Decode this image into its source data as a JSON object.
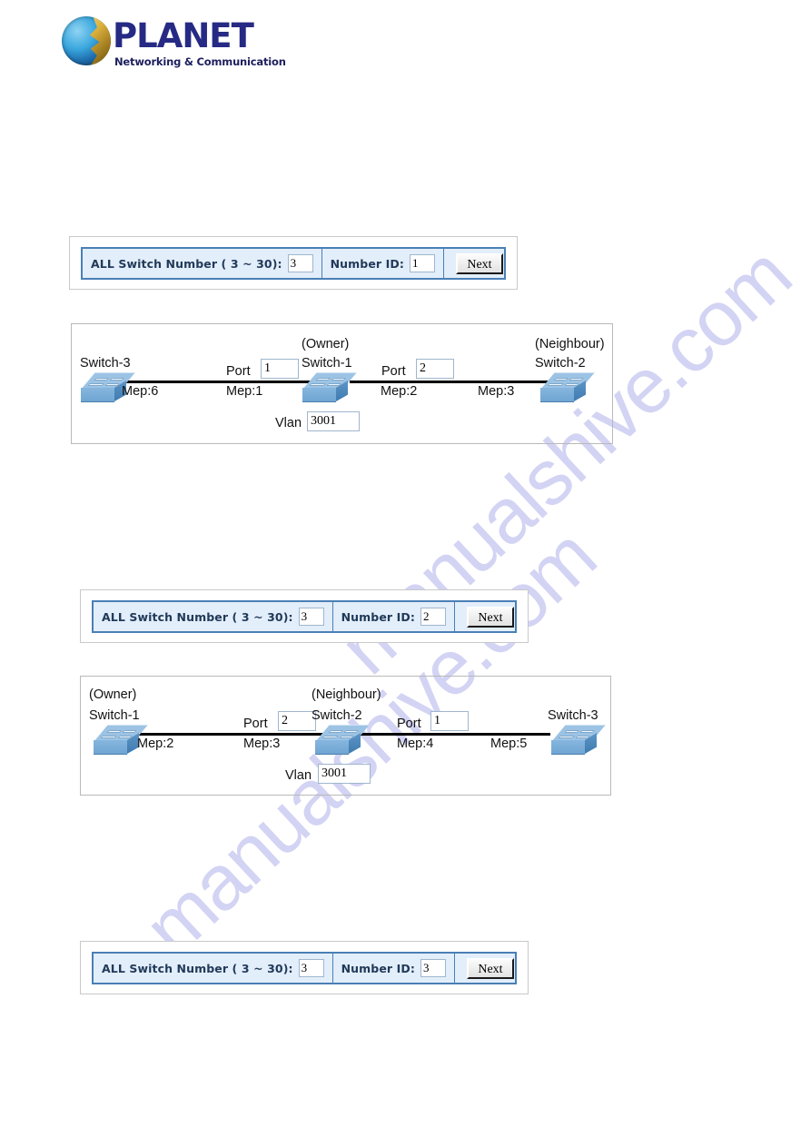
{
  "brand": {
    "name": "PLANET",
    "tagline": "Networking & Communication",
    "logo_icon": "planet-globe-icon",
    "word_color": "#262a84"
  },
  "watermark": {
    "line1": "manualshive.com",
    "line2": "manualshive.com",
    "color": "#b9b9ee"
  },
  "forms": [
    {
      "switch_number_label": "ALL Switch Number ( 3 ~ 30):",
      "switch_number_value": "3",
      "number_id_label": "Number ID:",
      "number_id_value": "1",
      "next_label": "Next"
    },
    {
      "switch_number_label": "ALL Switch Number ( 3 ~ 30):",
      "switch_number_value": "3",
      "number_id_label": "Number ID:",
      "number_id_value": "2",
      "next_label": "Next"
    },
    {
      "switch_number_label": "ALL Switch Number ( 3 ~ 30):",
      "switch_number_value": "3",
      "number_id_label": "Number ID:",
      "number_id_value": "3",
      "next_label": "Next"
    }
  ],
  "diagrams": [
    {
      "nodes": [
        {
          "role": "",
          "name": "Switch-3",
          "icon": "switch-icon"
        },
        {
          "role": "(Owner)",
          "name": "Switch-1",
          "icon": "switch-icon"
        },
        {
          "role": "(Neighbour)",
          "name": "Switch-2",
          "icon": "switch-icon"
        }
      ],
      "port_label_left": "Port",
      "port_value_left": "1",
      "port_label_right": "Port",
      "port_value_right": "2",
      "mep_left_outer": "Mep:6",
      "mep_left_inner": "Mep:1",
      "mep_right_inner": "Mep:2",
      "mep_right_outer": "Mep:3",
      "vlan_label": "Vlan",
      "vlan_value": "3001"
    },
    {
      "nodes": [
        {
          "role": "(Owner)",
          "name": "Switch-1",
          "icon": "switch-icon"
        },
        {
          "role": "(Neighbour)",
          "name": "Switch-2",
          "icon": "switch-icon"
        },
        {
          "role": "",
          "name": "Switch-3",
          "icon": "switch-icon"
        }
      ],
      "port_label_left": "Port",
      "port_value_left": "2",
      "port_label_right": "Port",
      "port_value_right": "1",
      "mep_left_outer": "Mep:2",
      "mep_left_inner": "Mep:3",
      "mep_right_inner": "Mep:4",
      "mep_right_outer": "Mep:5",
      "vlan_label": "Vlan",
      "vlan_value": "3001"
    }
  ]
}
